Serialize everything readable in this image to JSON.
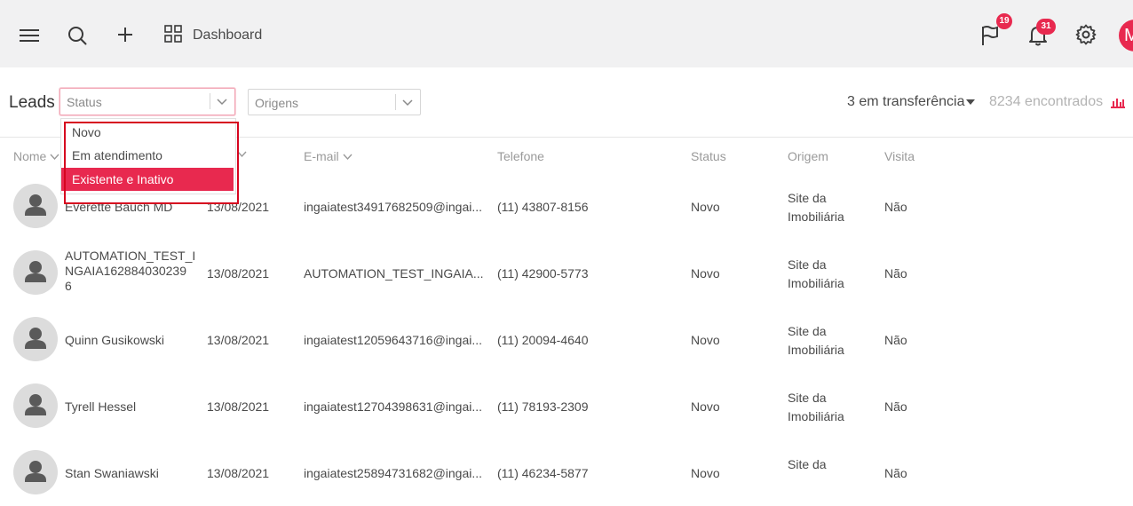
{
  "topbar": {
    "dashboard_label": "Dashboard",
    "flag_badge": "19",
    "bell_badge": "31",
    "avatar_letter": "M",
    "icons": [
      "menu-icon",
      "search-icon",
      "plus-icon",
      "dashboard-grid-icon",
      "flag-icon",
      "bell-icon",
      "gear-icon"
    ]
  },
  "filters": {
    "title": "Leads",
    "status_placeholder": "Status",
    "origens_placeholder": "Origens",
    "transfer_label": "3 em transferência",
    "found_label": "8234 encontrados"
  },
  "status_options": [
    "Novo",
    "Em atendimento",
    "Existente e Inativo"
  ],
  "selected_option_index": 2,
  "columns": [
    "Nome",
    "",
    "E-mail",
    "Telefone",
    "Status",
    "Origem",
    "Visita"
  ],
  "rows": [
    {
      "name": "Everette Bauch MD",
      "date": "13/08/2021",
      "email": "ingaiatest34917682509@ingai...",
      "phone": "(11) 43807-8156",
      "status": "Novo",
      "origem1": "Site da",
      "origem2": "Imobiliária",
      "visita": "Não"
    },
    {
      "name": "AUTOMATION_TEST_I\nNGAIA162884030239\n6",
      "date": "13/08/2021",
      "email": "AUTOMATION_TEST_INGAIA...",
      "phone": "(11) 42900-5773",
      "status": "Novo",
      "origem1": "Site da",
      "origem2": "Imobiliária",
      "visita": "Não"
    },
    {
      "name": "Quinn Gusikowski",
      "date": "13/08/2021",
      "email": "ingaiatest12059643716@ingai...",
      "phone": "(11) 20094-4640",
      "status": "Novo",
      "origem1": "Site da",
      "origem2": "Imobiliária",
      "visita": "Não"
    },
    {
      "name": "Tyrell Hessel",
      "date": "13/08/2021",
      "email": "ingaiatest12704398631@ingai...",
      "phone": "(11) 78193-2309",
      "status": "Novo",
      "origem1": "Site da",
      "origem2": "Imobiliária",
      "visita": "Não"
    },
    {
      "name": "Stan Swaniawski",
      "date": "13/08/2021",
      "email": "ingaiatest25894731682@ingai...",
      "phone": "(11) 46234-5877",
      "status": "Novo",
      "origem1": "Site da",
      "origem2": "",
      "visita": "Não"
    }
  ],
  "colors": {
    "accent": "#e8294f",
    "highlight_box": "#d6051f",
    "topbar_bg": "#f1f1f2"
  }
}
